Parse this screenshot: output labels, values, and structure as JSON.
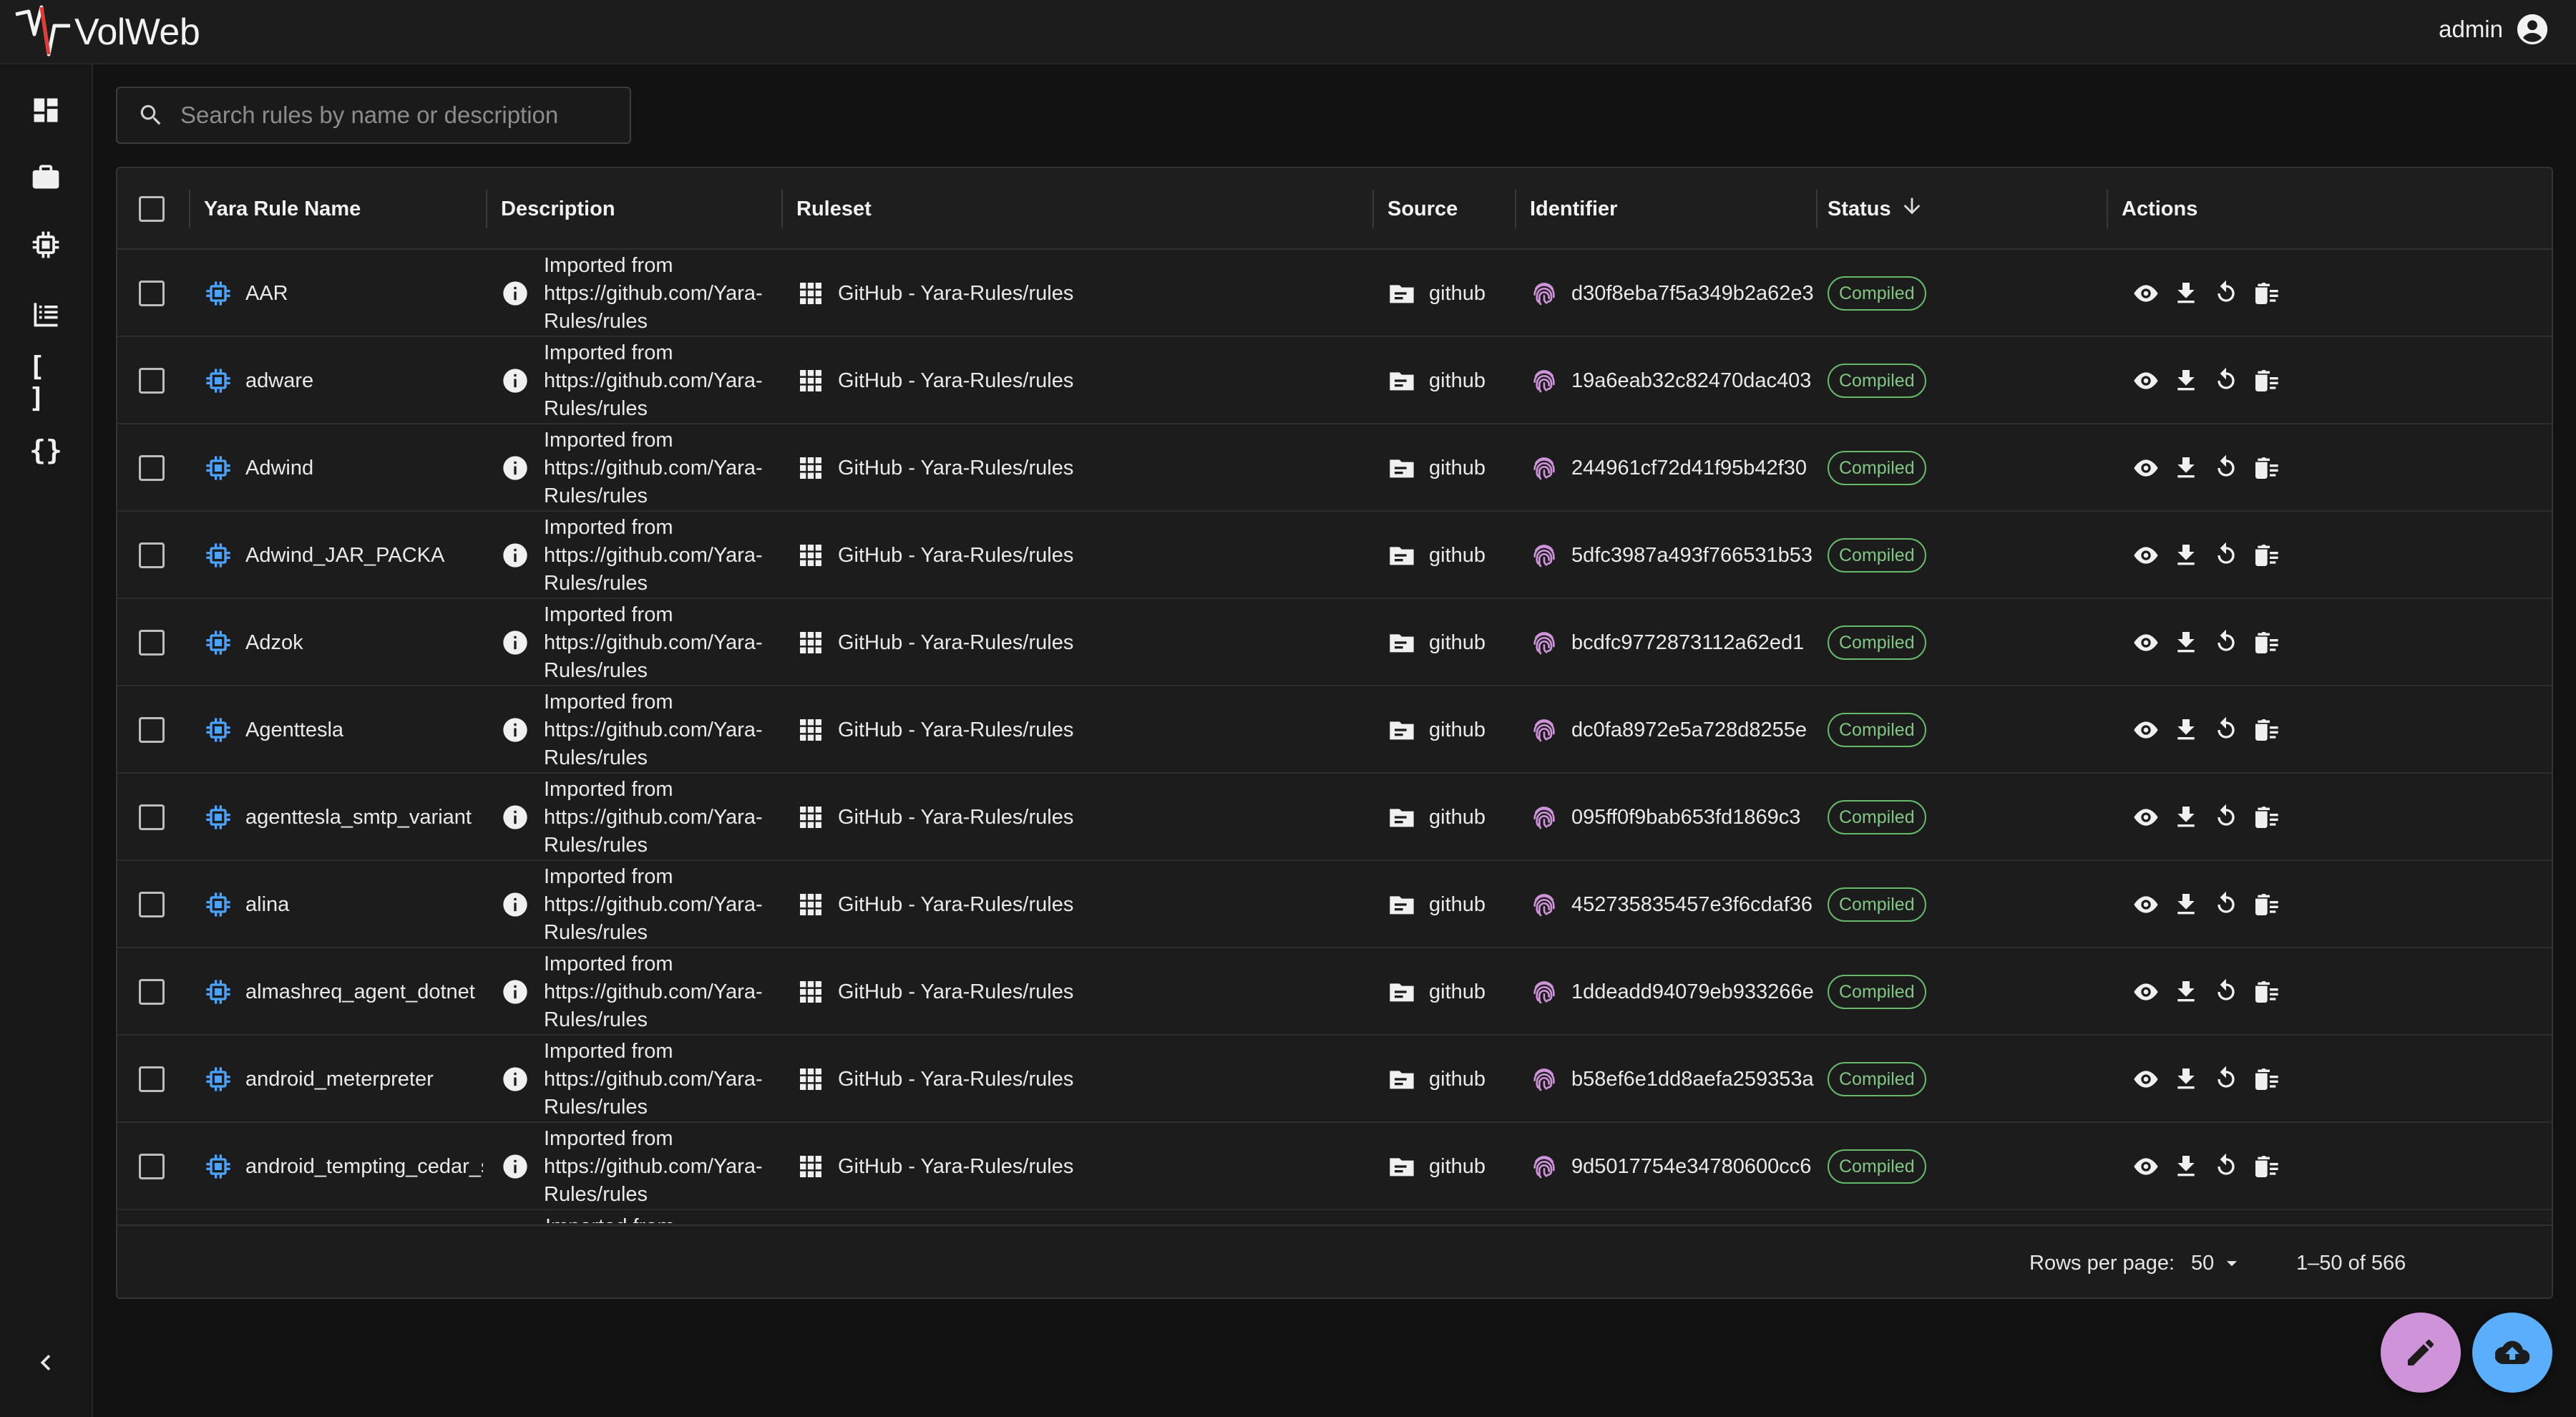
{
  "app": {
    "name": "VolWeb",
    "user": "admin"
  },
  "colors": {
    "accent_cpu": "#4aa3ff",
    "fingerprint": "#ce93d8",
    "compiled": "#66bb6a",
    "fab_edit": "#ce93d8",
    "fab_upload": "#5aaefc"
  },
  "sidebar": {
    "items": [
      {
        "icon": "dashboard-icon"
      },
      {
        "icon": "briefcase-icon"
      },
      {
        "icon": "cpu-chip-icon"
      },
      {
        "icon": "list-icon"
      },
      {
        "icon": "brackets-icon",
        "text": "[ ]"
      },
      {
        "icon": "curly-braces-icon",
        "text": "{}"
      }
    ],
    "collapse_icon": "chevron-left-icon"
  },
  "search": {
    "placeholder": "Search rules by name or description",
    "value": ""
  },
  "table": {
    "columns": {
      "name": "Yara Rule Name",
      "description": "Description",
      "ruleset": "Ruleset",
      "source": "Source",
      "identifier": "Identifier",
      "status": "Status",
      "actions": "Actions"
    },
    "sort": {
      "column": "Status",
      "direction": "descending",
      "icon": "arrow-down-icon"
    },
    "rows": [
      {
        "name": "AAR",
        "description": "Imported from https://github.com/Yara-Rules/rules",
        "ruleset": "GitHub - Yara-Rules/rules",
        "source": "github",
        "identifier": "d30f8eba7f5a349b2a62e3",
        "status": "Compiled"
      },
      {
        "name": "adware",
        "description": "Imported from https://github.com/Yara-Rules/rules",
        "ruleset": "GitHub - Yara-Rules/rules",
        "source": "github",
        "identifier": "19a6eab32c82470dac403",
        "status": "Compiled"
      },
      {
        "name": "Adwind",
        "description": "Imported from https://github.com/Yara-Rules/rules",
        "ruleset": "GitHub - Yara-Rules/rules",
        "source": "github",
        "identifier": "244961cf72d41f95b42f30",
        "status": "Compiled"
      },
      {
        "name": "Adwind_JAR_PACKA",
        "description": "Imported from https://github.com/Yara-Rules/rules",
        "ruleset": "GitHub - Yara-Rules/rules",
        "source": "github",
        "identifier": "5dfc3987a493f766531b53",
        "status": "Compiled"
      },
      {
        "name": "Adzok",
        "description": "Imported from https://github.com/Yara-Rules/rules",
        "ruleset": "GitHub - Yara-Rules/rules",
        "source": "github",
        "identifier": "bcdfc9772873112a62ed1",
        "status": "Compiled"
      },
      {
        "name": "Agenttesla",
        "description": "Imported from https://github.com/Yara-Rules/rules",
        "ruleset": "GitHub - Yara-Rules/rules",
        "source": "github",
        "identifier": "dc0fa8972e5a728d8255e",
        "status": "Compiled"
      },
      {
        "name": "agenttesla_smtp_variant",
        "description": "Imported from https://github.com/Yara-Rules/rules",
        "ruleset": "GitHub - Yara-Rules/rules",
        "source": "github",
        "identifier": "095ff0f9bab653fd1869c3",
        "status": "Compiled"
      },
      {
        "name": "alina",
        "description": "Imported from https://github.com/Yara-Rules/rules",
        "ruleset": "GitHub - Yara-Rules/rules",
        "source": "github",
        "identifier": "452735835457e3f6cdaf36",
        "status": "Compiled"
      },
      {
        "name": "almashreq_agent_dotnet",
        "description": "Imported from https://github.com/Yara-Rules/rules",
        "ruleset": "GitHub - Yara-Rules/rules",
        "source": "github",
        "identifier": "1ddeadd94079eb933266e",
        "status": "Compiled"
      },
      {
        "name": "android_meterpreter",
        "description": "Imported from https://github.com/Yara-Rules/rules",
        "ruleset": "GitHub - Yara-Rules/rules",
        "source": "github",
        "identifier": "b58ef6e1dd8aefa259353a",
        "status": "Compiled"
      },
      {
        "name": "android_tempting_cedar_s",
        "description": "Imported from https://github.com/Yara-Rules/rules",
        "ruleset": "GitHub - Yara-Rules/rules",
        "source": "github",
        "identifier": "9d5017754e34780600cc6",
        "status": "Compiled"
      }
    ],
    "partial_row_text": "Imported from",
    "row_icons": {
      "name": "cpu-chip-icon",
      "description": "info-icon",
      "ruleset": "grid-icon",
      "source": "folder-icon",
      "identifier": "fingerprint-icon",
      "actions": [
        "view-icon",
        "download-icon",
        "refresh-icon",
        "delete-icon"
      ]
    }
  },
  "pagination": {
    "rows_per_page_label": "Rows per page:",
    "rows_per_page": "50",
    "range": "1–50 of 566"
  },
  "fabs": [
    {
      "icon": "pencil-icon"
    },
    {
      "icon": "cloud-upload-icon"
    }
  ]
}
